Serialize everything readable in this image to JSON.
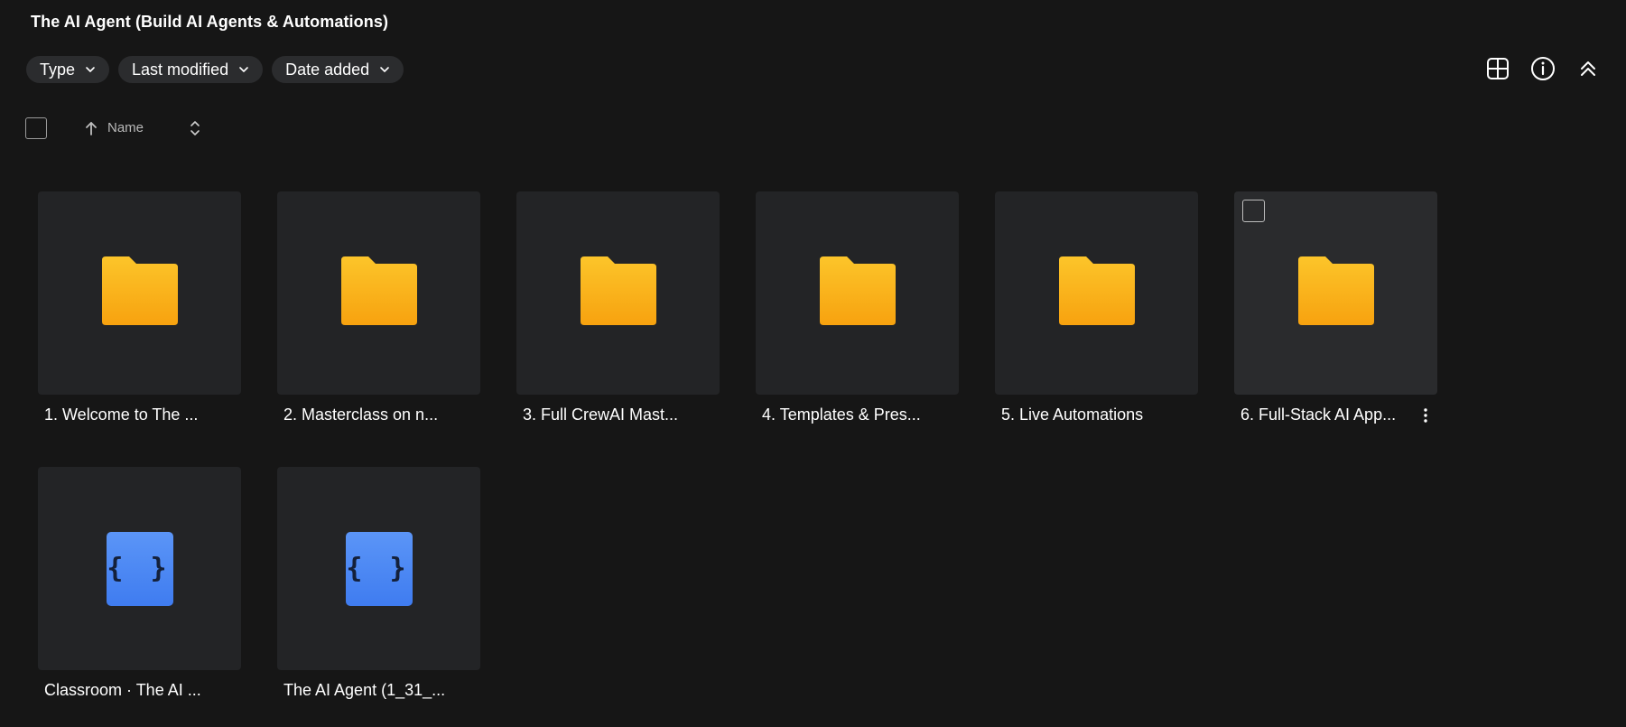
{
  "header": {
    "title": "The AI Agent (Build AI Agents & Automations)"
  },
  "filters": [
    {
      "label": "Type"
    },
    {
      "label": "Last modified"
    },
    {
      "label": "Date added"
    }
  ],
  "toolbar": {
    "icons": [
      "grid-view-icon",
      "info-icon",
      "collapse-icon"
    ]
  },
  "list_header": {
    "sort_label": "Name"
  },
  "items": [
    {
      "label": "1. Welcome to The ...",
      "kind": "folder"
    },
    {
      "label": "2. Masterclass on n...",
      "kind": "folder"
    },
    {
      "label": "3. Full CrewAI Mast...",
      "kind": "folder"
    },
    {
      "label": "4. Templates & Pres...",
      "kind": "folder"
    },
    {
      "label": "5. Live Automations",
      "kind": "folder"
    },
    {
      "label": "6. Full-Stack AI App...",
      "kind": "folder",
      "hovered": true
    },
    {
      "label": "Classroom · The AI ...",
      "kind": "json"
    },
    {
      "label": "The AI Agent (1_31_...",
      "kind": "json"
    }
  ],
  "json_glyph": "{ }",
  "colors": {
    "background": "#161616",
    "tile": "#232426",
    "chip": "#2b2c2e",
    "folder": "#fbb516",
    "json": "#4a86f4"
  }
}
